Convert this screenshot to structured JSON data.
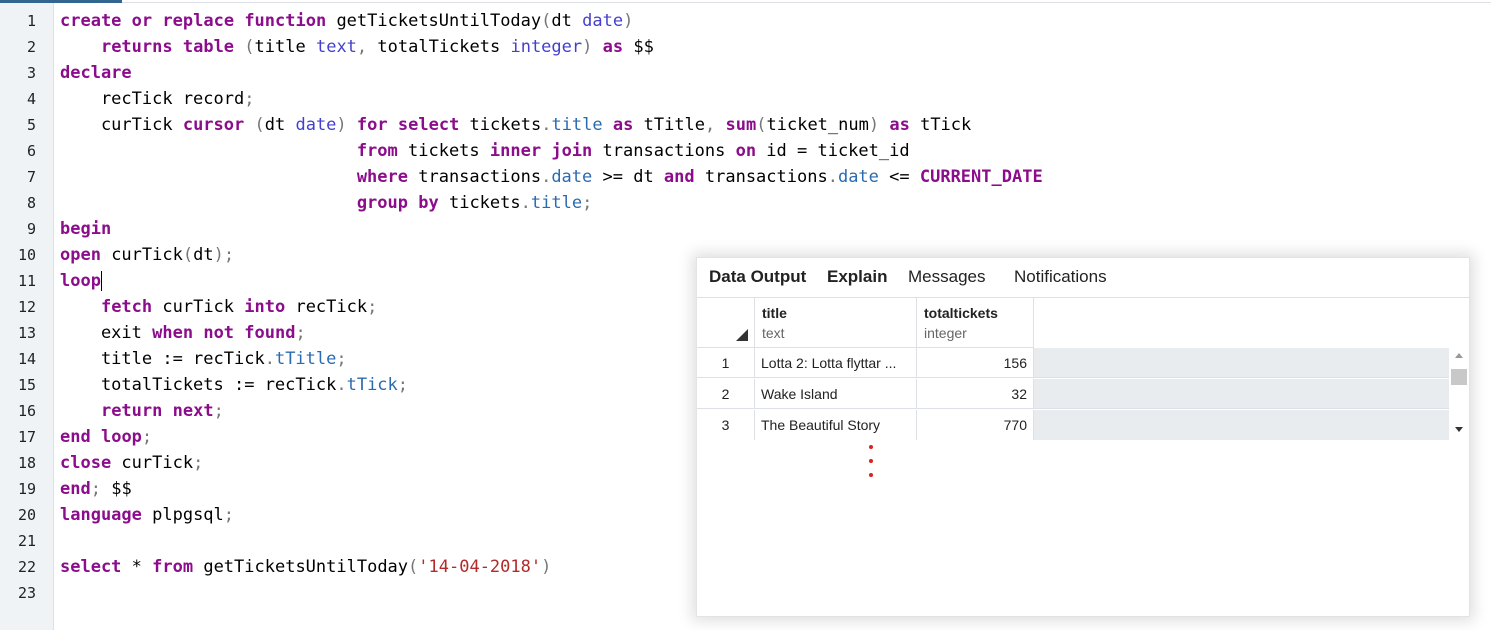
{
  "editor": {
    "line_numbers": [
      "1",
      "2",
      "3",
      "4",
      "5",
      "6",
      "7",
      "8",
      "9",
      "10",
      "11",
      "12",
      "13",
      "14",
      "15",
      "16",
      "17",
      "18",
      "19",
      "20",
      "21",
      "22",
      "23"
    ],
    "lines": [
      {
        "tokens": [
          [
            "kw",
            "create"
          ],
          [
            "t",
            " "
          ],
          [
            "kw",
            "or"
          ],
          [
            "t",
            " "
          ],
          [
            "kw",
            "replace"
          ],
          [
            "t",
            " "
          ],
          [
            "kw",
            "function"
          ],
          [
            "t",
            " getTicketsUntilToday"
          ],
          [
            "pu",
            "("
          ],
          [
            "t",
            "dt "
          ],
          [
            "ty",
            "date"
          ],
          [
            "pu",
            ")"
          ]
        ]
      },
      {
        "tokens": [
          [
            "t",
            "    "
          ],
          [
            "kw",
            "returns"
          ],
          [
            "t",
            " "
          ],
          [
            "kw",
            "table"
          ],
          [
            "t",
            " "
          ],
          [
            "pu",
            "("
          ],
          [
            "t",
            "title "
          ],
          [
            "ty",
            "text"
          ],
          [
            "pu",
            ","
          ],
          [
            "t",
            " totalTickets "
          ],
          [
            "ty",
            "integer"
          ],
          [
            "pu",
            ")"
          ],
          [
            "t",
            " "
          ],
          [
            "kw",
            "as"
          ],
          [
            "t",
            " $$"
          ]
        ]
      },
      {
        "tokens": [
          [
            "kw",
            "declare"
          ]
        ]
      },
      {
        "tokens": [
          [
            "t",
            "    recTick record"
          ],
          [
            "pu",
            ";"
          ]
        ]
      },
      {
        "tokens": [
          [
            "t",
            "    curTick "
          ],
          [
            "kw",
            "cursor"
          ],
          [
            "t",
            " "
          ],
          [
            "pu",
            "("
          ],
          [
            "t",
            "dt "
          ],
          [
            "ty",
            "date"
          ],
          [
            "pu",
            ")"
          ],
          [
            "t",
            " "
          ],
          [
            "kw",
            "for"
          ],
          [
            "t",
            " "
          ],
          [
            "kw",
            "select"
          ],
          [
            "t",
            " tickets"
          ],
          [
            "pu",
            "."
          ],
          [
            "pp",
            "title"
          ],
          [
            "t",
            " "
          ],
          [
            "kw",
            "as"
          ],
          [
            "t",
            " tTitle"
          ],
          [
            "pu",
            ","
          ],
          [
            "t",
            " "
          ],
          [
            "kw",
            "sum"
          ],
          [
            "pu",
            "("
          ],
          [
            "t",
            "ticket_num"
          ],
          [
            "pu",
            ")"
          ],
          [
            "t",
            " "
          ],
          [
            "kw",
            "as"
          ],
          [
            "t",
            " tTick"
          ]
        ]
      },
      {
        "tokens": [
          [
            "t",
            "                             "
          ],
          [
            "kw",
            "from"
          ],
          [
            "t",
            " tickets "
          ],
          [
            "kw",
            "inner"
          ],
          [
            "t",
            " "
          ],
          [
            "kw",
            "join"
          ],
          [
            "t",
            " transactions "
          ],
          [
            "kw",
            "on"
          ],
          [
            "t",
            " id = ticket_id"
          ]
        ]
      },
      {
        "tokens": [
          [
            "t",
            "                             "
          ],
          [
            "kw",
            "where"
          ],
          [
            "t",
            " transactions"
          ],
          [
            "pu",
            "."
          ],
          [
            "pp",
            "date"
          ],
          [
            "t",
            " >= dt "
          ],
          [
            "kw",
            "and"
          ],
          [
            "t",
            " transactions"
          ],
          [
            "pu",
            "."
          ],
          [
            "pp",
            "date"
          ],
          [
            "t",
            " <= "
          ],
          [
            "kw",
            "CURRENT_DATE"
          ]
        ]
      },
      {
        "tokens": [
          [
            "t",
            "                             "
          ],
          [
            "kw",
            "group"
          ],
          [
            "t",
            " "
          ],
          [
            "kw",
            "by"
          ],
          [
            "t",
            " tickets"
          ],
          [
            "pu",
            "."
          ],
          [
            "pp",
            "title"
          ],
          [
            "pu",
            ";"
          ]
        ]
      },
      {
        "tokens": [
          [
            "kw",
            "begin"
          ]
        ]
      },
      {
        "tokens": [
          [
            "kw",
            "open"
          ],
          [
            "t",
            " curTick"
          ],
          [
            "pu",
            "("
          ],
          [
            "t",
            "dt"
          ],
          [
            "pu",
            ")"
          ],
          [
            "pu",
            ";"
          ]
        ]
      },
      {
        "tokens": [
          [
            "kw",
            "loop"
          ],
          [
            "caret",
            ""
          ]
        ]
      },
      {
        "tokens": [
          [
            "t",
            "    "
          ],
          [
            "kw",
            "fetch"
          ],
          [
            "t",
            " curTick "
          ],
          [
            "kw",
            "into"
          ],
          [
            "t",
            " recTick"
          ],
          [
            "pu",
            ";"
          ]
        ]
      },
      {
        "tokens": [
          [
            "t",
            "    exit "
          ],
          [
            "kw",
            "when"
          ],
          [
            "t",
            " "
          ],
          [
            "kw",
            "not"
          ],
          [
            "t",
            " "
          ],
          [
            "kw",
            "found"
          ],
          [
            "pu",
            ";"
          ]
        ]
      },
      {
        "tokens": [
          [
            "t",
            "    title := recTick"
          ],
          [
            "pu",
            "."
          ],
          [
            "pp",
            "tTitle"
          ],
          [
            "pu",
            ";"
          ]
        ]
      },
      {
        "tokens": [
          [
            "t",
            "    totalTickets := recTick"
          ],
          [
            "pu",
            "."
          ],
          [
            "pp",
            "tTick"
          ],
          [
            "pu",
            ";"
          ]
        ]
      },
      {
        "tokens": [
          [
            "t",
            "    "
          ],
          [
            "kw",
            "return"
          ],
          [
            "t",
            " "
          ],
          [
            "kw",
            "next"
          ],
          [
            "pu",
            ";"
          ]
        ]
      },
      {
        "tokens": [
          [
            "kw",
            "end"
          ],
          [
            "t",
            " "
          ],
          [
            "kw",
            "loop"
          ],
          [
            "pu",
            ";"
          ]
        ]
      },
      {
        "tokens": [
          [
            "kw",
            "close"
          ],
          [
            "t",
            " curTick"
          ],
          [
            "pu",
            ";"
          ]
        ]
      },
      {
        "tokens": [
          [
            "kw",
            "end"
          ],
          [
            "pu",
            ";"
          ],
          [
            "t",
            " $$"
          ]
        ]
      },
      {
        "tokens": [
          [
            "kw",
            "language"
          ],
          [
            "t",
            " plpgsql"
          ],
          [
            "pu",
            ";"
          ]
        ]
      },
      {
        "tokens": []
      },
      {
        "tokens": [
          [
            "kw",
            "select"
          ],
          [
            "t",
            " * "
          ],
          [
            "kw",
            "from"
          ],
          [
            "t",
            " getTicketsUntilToday"
          ],
          [
            "pu",
            "("
          ],
          [
            "st",
            "'14-04-2018'"
          ],
          [
            "pu",
            ")"
          ]
        ]
      },
      {
        "tokens": []
      }
    ]
  },
  "results": {
    "tabs": [
      {
        "label": "Data Output",
        "active": true
      },
      {
        "label": "Explain",
        "active": true
      },
      {
        "label": "Messages",
        "active": false
      },
      {
        "label": "Notifications",
        "active": false
      }
    ],
    "columns": [
      {
        "name": "title",
        "type": "text"
      },
      {
        "name": "totaltickets",
        "type": "integer"
      }
    ],
    "rows": [
      {
        "index": "1",
        "title": "Lotta 2: Lotta flyttar ...",
        "total": "156"
      },
      {
        "index": "2",
        "title": "Wake Island",
        "total": "32"
      },
      {
        "index": "3",
        "title": "The Beautiful Story",
        "total": "770"
      }
    ],
    "continuation_icon": "vertical-ellipsis-icon",
    "continuation_color": "#e02020"
  }
}
